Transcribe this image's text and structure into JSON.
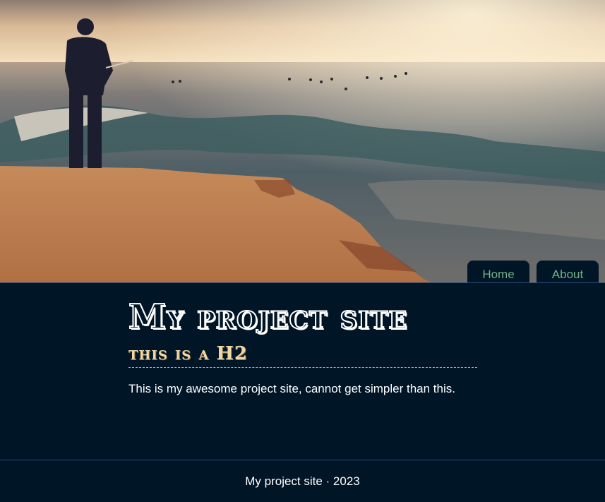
{
  "hero": {
    "image": "ocean-fisherman-photo"
  },
  "nav": {
    "items": [
      {
        "label": "Home"
      },
      {
        "label": "About"
      }
    ]
  },
  "main": {
    "title": "My project site",
    "subtitle": "this is a H2",
    "intro": "This is my awesome project site, cannot get simpler than this."
  },
  "footer": {
    "text": "My project site · 2023"
  },
  "colors": {
    "background": "#001526",
    "nav_text": "#6fb187",
    "subtitle": "#f1d6a6",
    "divider": "#2b4f77",
    "dashed_rule": "#d59a73"
  }
}
